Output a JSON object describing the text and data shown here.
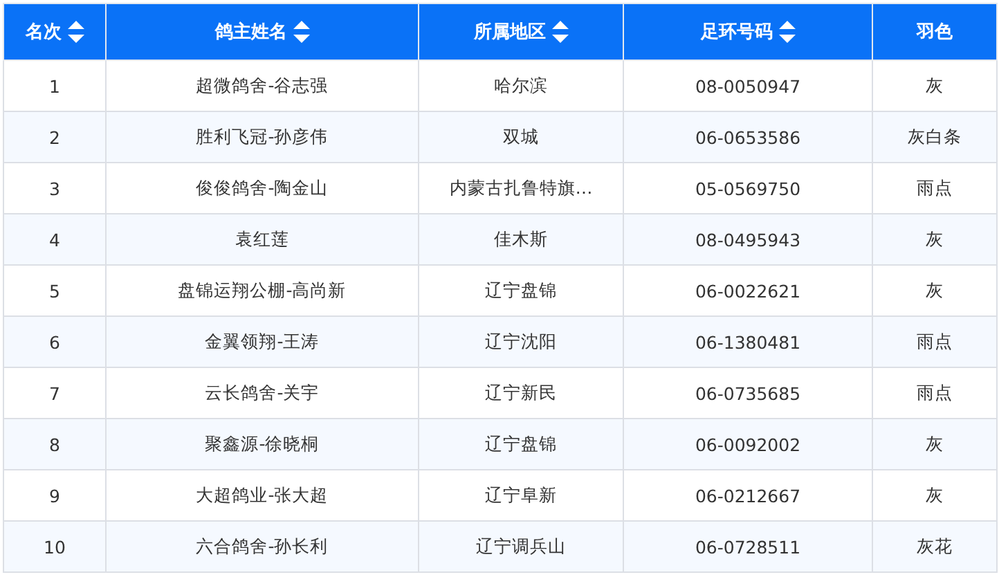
{
  "table": {
    "columns": [
      {
        "label": "名次",
        "sortable": true
      },
      {
        "label": "鸽主姓名",
        "sortable": true
      },
      {
        "label": "所属地区",
        "sortable": true
      },
      {
        "label": "足环号码",
        "sortable": true
      },
      {
        "label": "羽色",
        "sortable": false
      }
    ],
    "rows": [
      [
        "1",
        "超微鸽舍-谷志强",
        "哈尔滨",
        "08-0050947",
        "灰"
      ],
      [
        "2",
        "胜利飞冠-孙彦伟",
        "双城",
        "06-0653586",
        "灰白条"
      ],
      [
        "3",
        "俊俊鸽舍-陶金山",
        "内蒙古扎鲁特旗…",
        "05-0569750",
        "雨点"
      ],
      [
        "4",
        "袁红莲",
        "佳木斯",
        "08-0495943",
        "灰"
      ],
      [
        "5",
        "盘锦运翔公棚-高尚新",
        "辽宁盘锦",
        "06-0022621",
        "灰"
      ],
      [
        "6",
        "金翼领翔-王涛",
        "辽宁沈阳",
        "06-1380481",
        "雨点"
      ],
      [
        "7",
        "云长鸽舍-关宇",
        "辽宁新民",
        "06-0735685",
        "雨点"
      ],
      [
        "8",
        "聚鑫源-徐晓桐",
        "辽宁盘锦",
        "06-0092002",
        "灰"
      ],
      [
        "9",
        "大超鸽业-张大超",
        "辽宁阜新",
        "06-0212667",
        "灰"
      ],
      [
        "10",
        "六合鸽舍-孙长利",
        "辽宁调兵山",
        "06-0728511",
        "灰花"
      ]
    ]
  }
}
